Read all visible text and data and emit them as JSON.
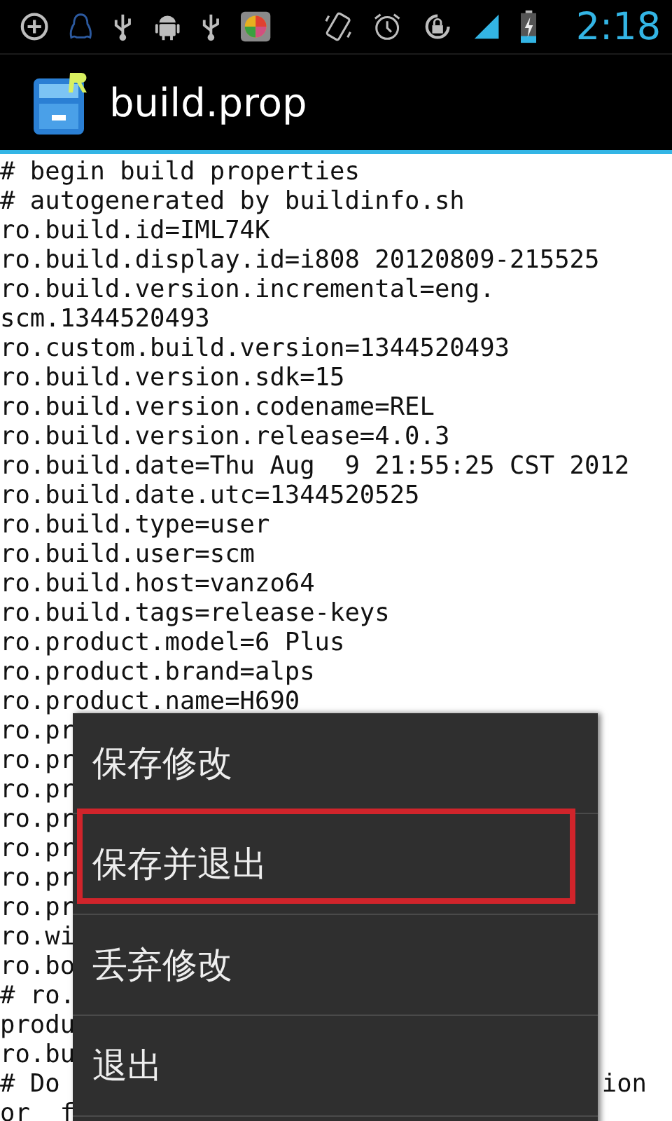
{
  "status_bar": {
    "time": "2:18",
    "icons": [
      {
        "kind": "add-circle"
      },
      {
        "kind": "penguin"
      },
      {
        "kind": "usb"
      },
      {
        "kind": "android"
      },
      {
        "kind": "usb"
      },
      {
        "kind": "app"
      },
      {
        "kind": "rotate-phone"
      },
      {
        "kind": "alarm"
      },
      {
        "kind": "rotation-lock"
      },
      {
        "kind": "signal"
      },
      {
        "kind": "battery"
      }
    ]
  },
  "action_bar": {
    "title": "build.prop"
  },
  "editor": {
    "lines": [
      {
        "text": "# begin build properties"
      },
      {
        "text": "# autogenerated by buildinfo.sh"
      },
      {
        "text": "ro.build.id=IML74K"
      },
      {
        "text": "ro.build.display.id=i808 20120809-215525"
      },
      {
        "text": "ro.build.version.incremental=eng."
      },
      {
        "text": "scm.1344520493"
      },
      {
        "text": "ro.custom.build.version=1344520493"
      },
      {
        "text": "ro.build.version.sdk=15"
      },
      {
        "text": "ro.build.version.codename=REL"
      },
      {
        "text": "ro.build.version.release=4.0.3"
      },
      {
        "text": "ro.build.date=Thu Aug  9 21:55:25 CST 2012"
      },
      {
        "text": "ro.build.date.utc=1344520525"
      },
      {
        "text": "ro.build.type=user"
      },
      {
        "text": "ro.build.user=scm"
      },
      {
        "text": "ro.build.host=vanzo64"
      },
      {
        "text": "ro.build.tags=release-keys"
      },
      {
        "text": "ro.product.model=6 Plus"
      },
      {
        "text": "ro.product.brand=alps"
      },
      {
        "text": "ro.product.name=H690"
      },
      {
        "text": "ro.pr"
      },
      {
        "text": "ro.pr"
      },
      {
        "text": "ro.pr"
      },
      {
        "text": "ro.pr"
      },
      {
        "text": "ro.pr"
      },
      {
        "text": "ro.pr"
      },
      {
        "text": "ro.pr"
      },
      {
        "text": "ro.wi"
      },
      {
        "text": "ro.bo"
      },
      {
        "text": "# ro."
      },
      {
        "text": "produ"
      },
      {
        "text": "ro.bu"
      },
      {
        "text": "# Do",
        "tail": "ion"
      },
      {
        "text": "or  f"
      }
    ]
  },
  "menu": {
    "items": [
      {
        "label": "保存修改",
        "highlighted": false
      },
      {
        "label": "保存并退出",
        "highlighted": true
      },
      {
        "label": "丢弃修改",
        "highlighted": false
      },
      {
        "label": "退出",
        "highlighted": false
      }
    ]
  }
}
